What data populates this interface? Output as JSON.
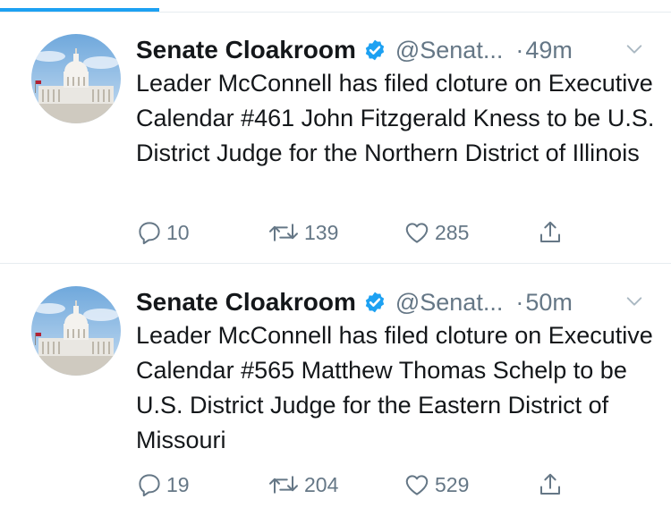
{
  "colors": {
    "accent": "#1da1f2",
    "secondary_text": "#657786",
    "primary_text": "#14171a",
    "divider": "#e6ecf0"
  },
  "tweets": [
    {
      "name": "Senate Cloakroom",
      "handle": "@Senat...",
      "separator": "·",
      "time": "49m",
      "text": "Leader McConnell has filed cloture on Executive Calendar #461 John Fitzgerald Kness to be U.S. District Judge for the Northern District of Illinois",
      "replies": "10",
      "retweets": "139",
      "likes": "285",
      "icons": [
        "reply-icon",
        "retweet-icon",
        "like-icon",
        "share-icon"
      ]
    },
    {
      "name": "Senate Cloakroom",
      "handle": "@Senat...",
      "separator": "·",
      "time": "50m",
      "text": "Leader McConnell has filed cloture on Executive Calendar #565 Matthew Thomas Schelp to be U.S. District Judge for the Eastern District of Missouri",
      "replies": "19",
      "retweets": "204",
      "likes": "529",
      "icons": [
        "reply-icon",
        "retweet-icon",
        "like-icon",
        "share-icon"
      ]
    }
  ]
}
